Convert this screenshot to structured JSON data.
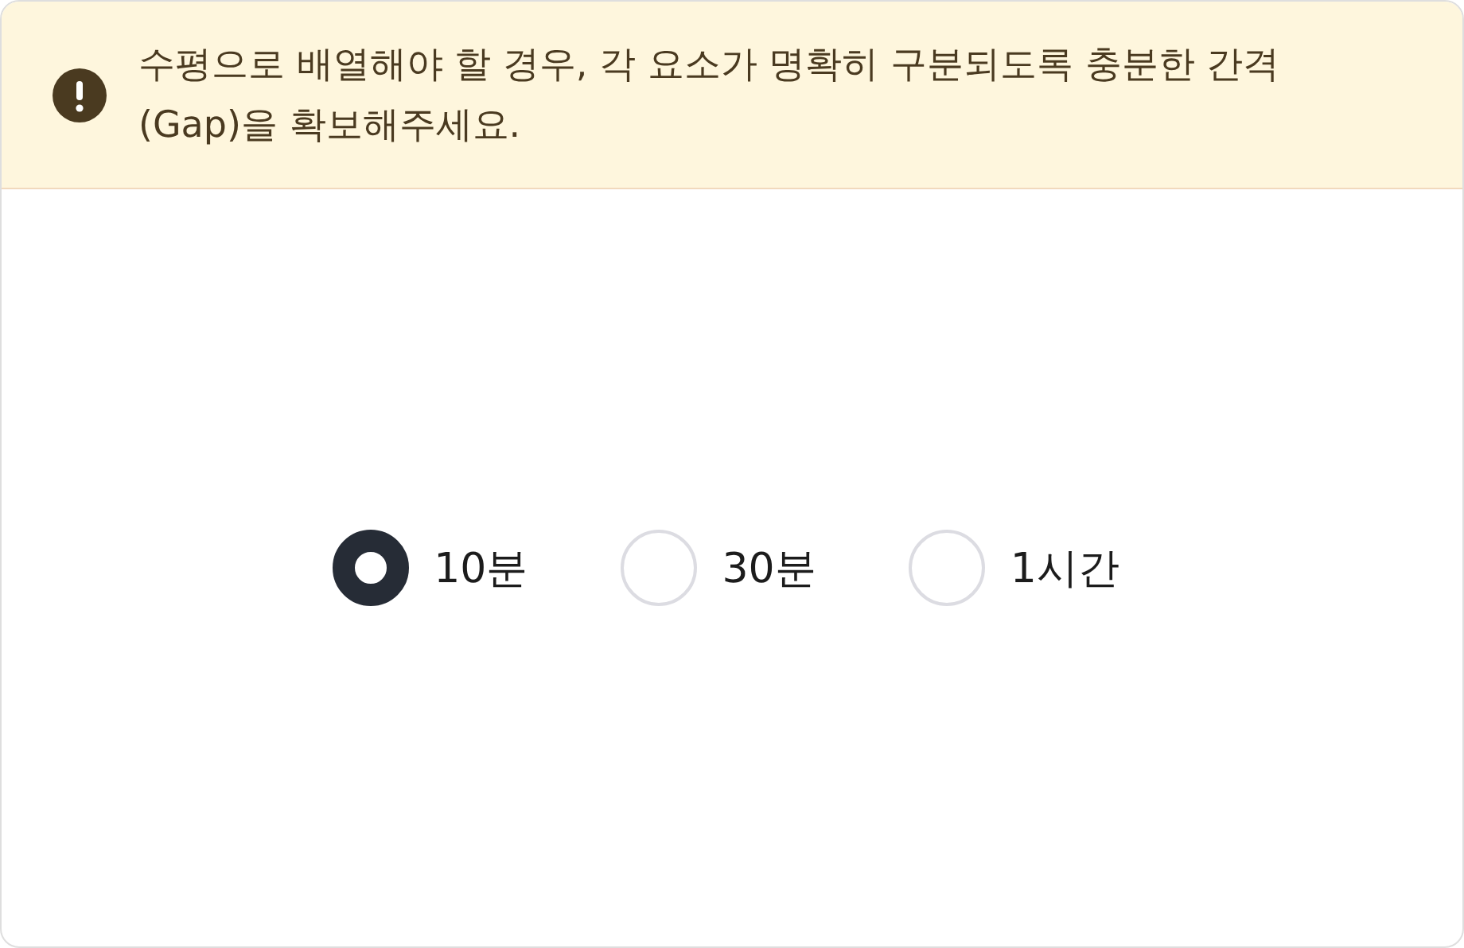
{
  "notice": {
    "kind": "warning",
    "text": "수평으로 배열해야 할 경우, 각 요소가 명확히 구분되도록 충분한 간격 (Gap)을 확보해주세요."
  },
  "options": [
    {
      "label": "10분",
      "selected": true
    },
    {
      "label": "30분",
      "selected": false
    },
    {
      "label": "1시간",
      "selected": false
    }
  ]
}
